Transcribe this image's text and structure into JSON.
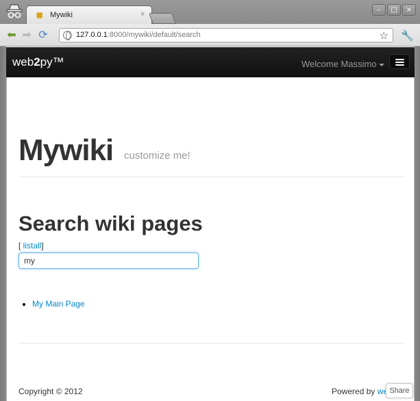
{
  "browser": {
    "tab_title": "Mywiki",
    "tab_favicon": "web2py-favicon",
    "tab_close": "×",
    "url_host": "127.0.0.1",
    "url_rest": ":8000/mywiki/default/search",
    "window_buttons": [
      "–",
      "□",
      "×"
    ]
  },
  "navbar": {
    "brand_prefix": "web",
    "brand_bold": "2",
    "brand_suffix": "py™",
    "welcome": "Welcome Massimo"
  },
  "header": {
    "title": "Mywiki",
    "subtitle": "customize me!"
  },
  "main": {
    "heading": "Search wiki pages",
    "listall_open": "[ ",
    "listall_label": "listall",
    "listall_close": "]",
    "search_value": "my",
    "results": [
      "My Main Page"
    ]
  },
  "footer": {
    "copyright": "Copyright © 2012",
    "powered_prefix": "Powered by ",
    "powered_link": "web2py",
    "share": "Share"
  },
  "colors": {
    "link": "#0088cc",
    "navbar": "#1b1b1b"
  }
}
